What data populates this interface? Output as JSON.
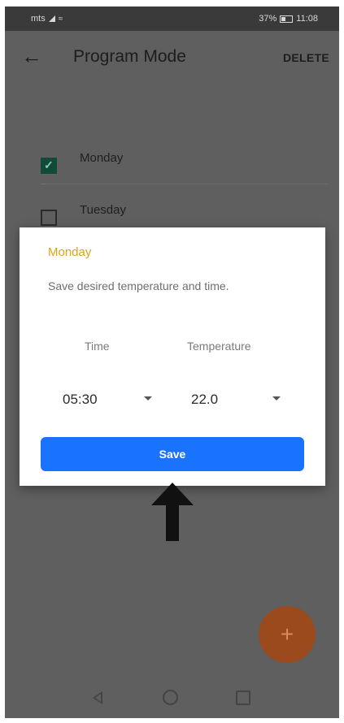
{
  "status_bar": {
    "carrier": "mts",
    "battery_percent": "37%",
    "time": "11:08"
  },
  "app_bar": {
    "title": "Program Mode",
    "delete_label": "DELETE"
  },
  "days": [
    {
      "label": "Monday",
      "checked": true
    },
    {
      "label": "Tuesday",
      "checked": false
    }
  ],
  "dialog": {
    "title": "Monday",
    "message": "Save desired temperature and time.",
    "time_label": "Time",
    "temperature_label": "Temperature",
    "time_value": "05:30",
    "temperature_value": "22.0",
    "save_label": "Save"
  },
  "fab": {
    "label": "+"
  },
  "colors": {
    "accent": "#1a73ff",
    "title_accent": "#d9a415",
    "fab": "#9a4a1c",
    "check": "#124a3a"
  }
}
